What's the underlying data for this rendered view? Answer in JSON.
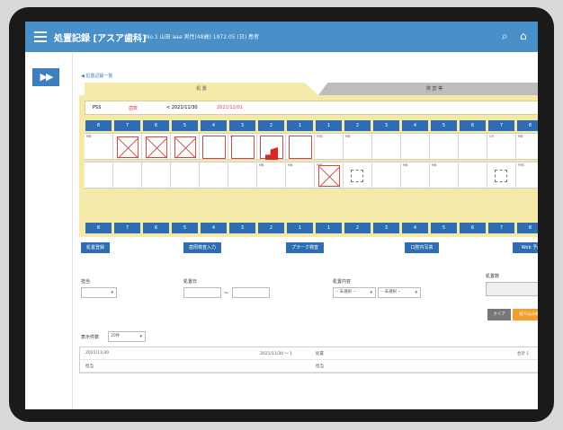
{
  "appbar": {
    "title": "処置記録 [アスア歯科]",
    "subtitle": "No.1 山田 aaa  男性(48歳) 1972.05 (日) 患者",
    "search_icon": "search-icon",
    "home_icon": "home-icon",
    "color": "#4a90c8"
  },
  "sidebar": {
    "toggle_label": "▶▶"
  },
  "breadcrumb": "◀ 処置記録一覧",
  "tabs": [
    {
      "label": "処 置",
      "active": true
    },
    {
      "label": "検 査 等",
      "active": false
    }
  ],
  "filter": {
    "label1": "PSS",
    "label2": "歯数",
    "date_from": "< 2021/11/30",
    "date_to": "2021/12/01"
  },
  "upper_teeth": [
    "8",
    "7",
    "6",
    "5",
    "4",
    "3",
    "2",
    "1",
    "1",
    "2",
    "3",
    "4",
    "5",
    "6",
    "7",
    "8"
  ],
  "lower_teeth": [
    "8",
    "7",
    "6",
    "5",
    "4",
    "3",
    "2",
    "1",
    "1",
    "2",
    "3",
    "4",
    "5",
    "6",
    "7",
    "8"
  ],
  "upper_chart_labels": [
    "MB",
    "",
    "",
    "",
    "",
    "Cr",
    "",
    "",
    "FMC",
    "MB",
    "",
    "",
    "",
    "",
    "CR",
    "MB"
  ],
  "lower_chart_labels": [
    "",
    "",
    "",
    "",
    "",
    "",
    "MB",
    "MB",
    "FMC",
    "",
    "",
    "MB",
    "MB",
    "",
    "",
    "FMC"
  ],
  "actions": {
    "btn1": "処置登録",
    "btn2": "歯周検査入力",
    "btn3": "プラーク検査",
    "btn4": "口腔内写真",
    "btn5": "Web 予約"
  },
  "form": {
    "field1_label": "担当",
    "field2_label": "処置日",
    "field3_label": "処置内容",
    "field3_opt1": "-- 未選択 --",
    "field3_opt2": "-- 未選択 --",
    "field4_label": "処置数",
    "range_sep": "〜",
    "clear_label": "クリア",
    "search_label": "絞り込み検索"
  },
  "list": {
    "sort_label": "表示件数",
    "sort_value": "20件",
    "rows": [
      {
        "left": "2021/11/30",
        "mid": "2021/11/30 〜 1",
        "right1": "処置",
        "right2": "合計 1"
      },
      {
        "left": "担当",
        "mid": "",
        "right1": "担当",
        "right2": ""
      }
    ]
  },
  "colors": {
    "panel": "#f4e9a8",
    "tooth_header": "#2f6db3",
    "mark_red": "#d64545",
    "accent_orange": "#f0a030"
  }
}
